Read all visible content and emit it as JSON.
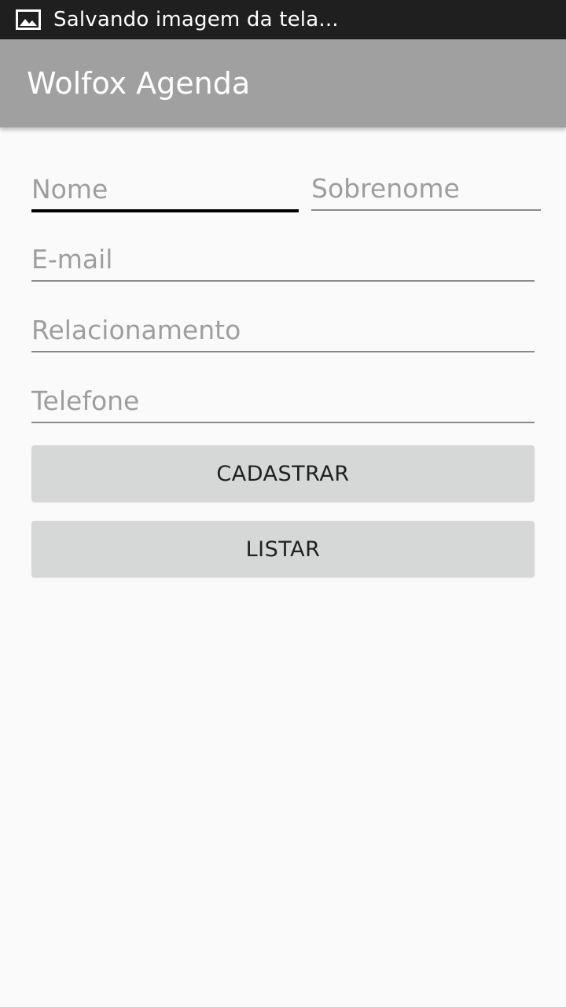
{
  "status_bar": {
    "icon": "image-icon",
    "text": "Salvando imagem da tela..."
  },
  "app_bar": {
    "title": "Wolfox Agenda",
    "background": "#a0a0a0"
  },
  "form": {
    "nome": {
      "placeholder": "Nome",
      "value": ""
    },
    "sobrenome": {
      "placeholder": "Sobrenome",
      "value": ""
    },
    "email": {
      "placeholder": "E-mail",
      "value": ""
    },
    "relacionamento": {
      "placeholder": "Relacionamento",
      "value": ""
    },
    "telefone": {
      "placeholder": "Telefone",
      "value": ""
    }
  },
  "buttons": {
    "cadastrar_label": "CADASTRAR",
    "listar_label": "LISTAR"
  }
}
